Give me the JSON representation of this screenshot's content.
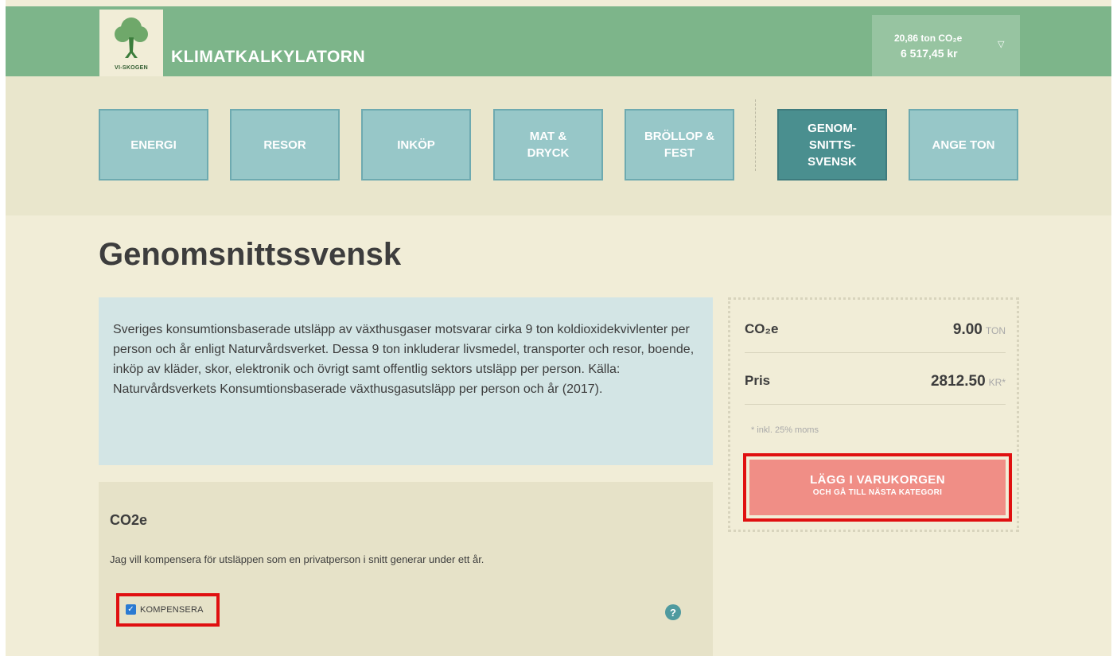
{
  "header": {
    "logo_text": "VI-SKOGEN",
    "app_title": "KLIMATKALKYLATORN",
    "cart_summary": {
      "co2": "20,86 ton CO₂e",
      "price": "6 517,45 kr"
    },
    "cart_caret": "▽"
  },
  "tabs": [
    {
      "label": "ENERGI"
    },
    {
      "label": "RESOR"
    },
    {
      "label": "INKÖP"
    },
    {
      "label": "MAT &\nDRYCK"
    },
    {
      "label": "BRÖLLOP &\nFEST"
    },
    {
      "label": "GENOM-\nSNITTS-\nSVENSK",
      "active": true
    },
    {
      "label": "ANGE TON"
    }
  ],
  "main": {
    "page_title": "Genomsnittssvensk",
    "info_text": "Sveriges konsumtionsbaserade utsläpp av växthusgaser motsvarar cirka 9 ton koldioxidekvivlenter per person och år enligt Naturvårdsverket. Dessa 9 ton inkluderar livsmedel, transporter och resor, boende, inköp av kläder, skor, elektronik och övrigt samt offentlig sektors utsläpp per person. Källa: Naturvårdsverkets Konsumtionsbaserade växthusgasutsläpp per person och år (2017).",
    "compensate": {
      "title": "CO2e",
      "description": "Jag vill kompensera för utsläppen som en privatperson i snitt generar under ett år.",
      "checkbox_label": "KOMPENSERA",
      "checked": true,
      "help_icon": "?"
    }
  },
  "summary": {
    "co2_label": "CO₂e",
    "co2_value": "9.00",
    "co2_unit": "TON",
    "price_label": "Pris",
    "price_value": "2812.50",
    "price_unit": "KR*",
    "note": "* inkl. 25% moms",
    "button_line1": "LÄGG I VARUKORGEN",
    "button_line2": "OCH GÅ TILL NÄSTA KATEGORI"
  },
  "colors": {
    "header_green": "#7db58a",
    "tab": "#97c7c8",
    "tab_active": "#4a8f8f",
    "cta": "#f08e86",
    "highlight": "#e01010"
  }
}
